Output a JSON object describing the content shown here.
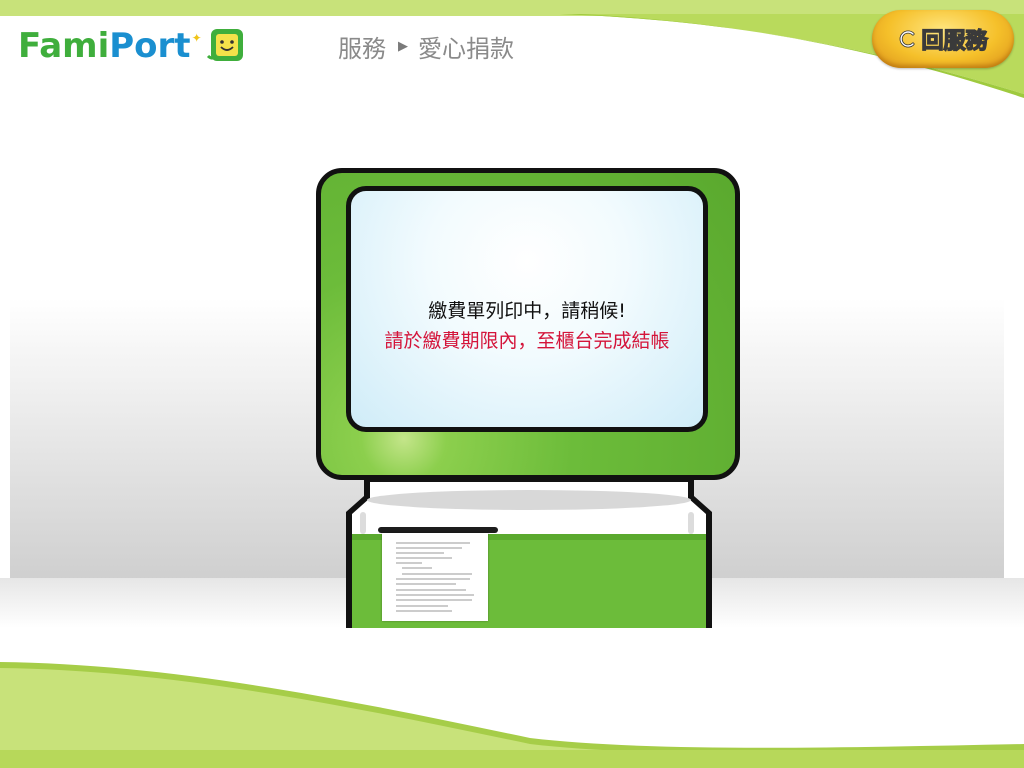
{
  "header": {
    "logo_part1": "Fami",
    "logo_part2": "Port",
    "breadcrumb": {
      "section": "服務",
      "separator": "▶",
      "current": "愛心捐款"
    },
    "back_button_label": "回服務"
  },
  "screen": {
    "message_line1": "繳費單列印中，請稍候!",
    "message_line2": "請於繳費期限內，至櫃台完成結帳"
  },
  "icons": {
    "logo_face": "smiley-face-icon",
    "back": "return-arrow-icon",
    "separator": "triangle-right-icon"
  },
  "colors": {
    "brand_green": "#3fae3c",
    "brand_blue": "#1a8fd0",
    "warning_red": "#d4143a",
    "accent_lime": "#b7d85a",
    "button_gold": "#f5c02a"
  }
}
